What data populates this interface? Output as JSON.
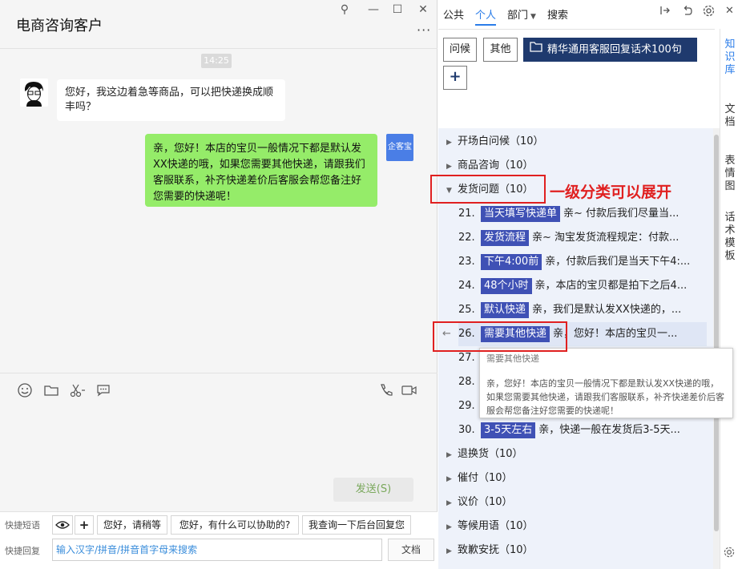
{
  "window": {
    "title": "电商咨询客户",
    "more": "···",
    "controls": [
      "⚲",
      "—",
      "☐",
      "✕"
    ]
  },
  "chat": {
    "time": "14:25",
    "incoming": "您好，我这边着急等商品，可以把快递换成顺丰吗？",
    "outgoing": "亲，您好！本店的宝贝一般情况下都是默认发XX快递的哦，如果您需要其他快递，请跟我们客服联系，补齐快递差价后客服会帮您备注好您需要的快递呢！",
    "bot_avatar": "企客宝",
    "send_label": "发送(S)"
  },
  "quick": {
    "label_phrases": "快捷短语",
    "label_reply": "快捷回复",
    "phrases": [
      "您好，请稍等",
      "您好，有什么可以协助的?",
      "我查询一下后台回复您"
    ],
    "search_placeholder": "输入汉字/拼音/拼音首字母来搜索",
    "doc_label": "文档"
  },
  "right": {
    "tabs": [
      "公共",
      "个人",
      "部门",
      "搜索"
    ],
    "active_tab": "个人",
    "tags": [
      "问候",
      "其他"
    ],
    "feature_tag": "精华通用客服回复话术100句",
    "add_label": "+",
    "categories_top": [
      {
        "label": "开场白问候（10）"
      },
      {
        "label": "商品咨询（10）"
      },
      {
        "label": "发货问题（10）"
      }
    ],
    "items": [
      {
        "num": "21.",
        "tag": "当天填写快递单",
        "text": "亲~ 付款后我们尽量当..."
      },
      {
        "num": "22.",
        "tag": "发货流程",
        "text": "亲~ 淘宝发货流程规定：付款..."
      },
      {
        "num": "23.",
        "tag": "下午4:00前",
        "text": "亲，付款后我们是当天下午4:..."
      },
      {
        "num": "24.",
        "tag": "48个小时",
        "text": "亲，本店的宝贝都是拍下之后4..."
      },
      {
        "num": "25.",
        "tag": "默认快递",
        "text": "亲，我们是默认发XX快递的，..."
      },
      {
        "num": "26.",
        "tag": "需要其他快递",
        "text": "亲，您好！本店的宝贝一..."
      },
      {
        "num": "27.",
        "tag": "",
        "text": ""
      },
      {
        "num": "28.",
        "tag": "",
        "text": ""
      },
      {
        "num": "29.",
        "tag": "",
        "text": ""
      },
      {
        "num": "30.",
        "tag": "3-5天左右",
        "text": "亲，快递一般在发货后3-5天..."
      }
    ],
    "categories_bottom": [
      {
        "label": "退换货（10）"
      },
      {
        "label": "催付（10）"
      },
      {
        "label": "议价（10）"
      },
      {
        "label": "等候用语（10）"
      },
      {
        "label": "致歉安抚（10）"
      }
    ],
    "tooltip_title": "需要其他快递",
    "tooltip_body": "亲，您好！本店的宝贝一般情况下都是默认发XX快递的哦，如果您需要其他快递，请跟我们客服联系，补齐快递差价后客服会帮您备注好您需要的快递呢！",
    "annotation": "一级分类可以展开",
    "side_tabs": [
      "知识库",
      "文档",
      "表情图",
      "话术模板"
    ]
  },
  "colors": {
    "accent": "#2b7de9",
    "bubble_out": "#95ec69",
    "tag_bg": "#3f51b5",
    "feature_bg": "#1f3a6e",
    "annotation": "#e02020"
  }
}
